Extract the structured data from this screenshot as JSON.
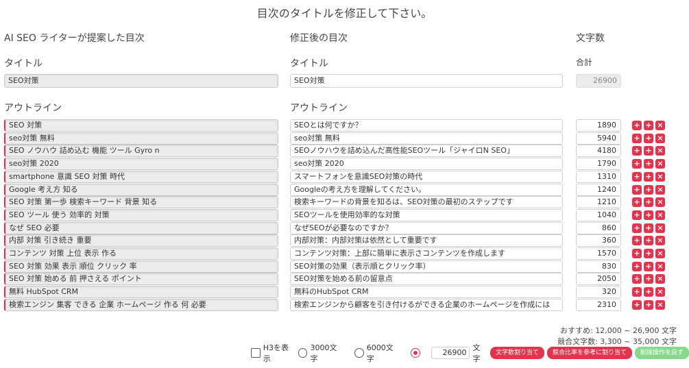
{
  "title": "目次のタイトルを修正して下さい。",
  "columns": {
    "ai_header": "AI SEO ライターが提案した目次",
    "edit_header": "修正後の目次",
    "count_header": "文字数"
  },
  "labels": {
    "title_label": "タイトル",
    "outline_label": "アウトライン",
    "total_label": "合計"
  },
  "title_fields": {
    "ai_title": "SEO対策",
    "edit_title": "SEO対策",
    "total": "26900"
  },
  "rows": [
    {
      "ai": "SEO 対策",
      "edit": "SEOとは何ですか？",
      "count": "1890"
    },
    {
      "ai": "seo対策 無料",
      "edit": "seo対策 無料",
      "count": "5940"
    },
    {
      "ai": "SEO ノウハウ 詰め込む 機能 ツール Gyro n",
      "edit": "SEOノウハウを詰め込んだ高性能SEOツール「ジャイロN SEO」",
      "count": "4180"
    },
    {
      "ai": "seo対策 2020",
      "edit": "seo対策 2020",
      "count": "1790"
    },
    {
      "ai": "smartphone 意識 SEO 対策 時代",
      "edit": "スマートフォンを意識SEO対策の時代",
      "count": "1310"
    },
    {
      "ai": "Google 考え方 知る",
      "edit": "Googleの考え方を理解してください。",
      "count": "1240"
    },
    {
      "ai": "SEO 対策 第一歩 検索キーワード 背景 知る",
      "edit": "検索キーワードの背景を知るは、SEO対策の最初のステップです",
      "count": "1210"
    },
    {
      "ai": "SEO ツール 使う 効率的 対策",
      "edit": "SEOツールを使用効率的な対策",
      "count": "1040"
    },
    {
      "ai": "なぜ SEO 必要",
      "edit": "なぜSEOが必要なのですか？",
      "count": "860"
    },
    {
      "ai": "内部 対策 引き続き 重要",
      "edit": "内部対策：内部対策は依然として重要です",
      "count": "360"
    },
    {
      "ai": "コンテンツ 対策 上位 表示 作る",
      "edit": "コンテンツ対策：上部に簡単に表示さコンテンツを作成します",
      "count": "1570"
    },
    {
      "ai": "SEO 対策 効果 表示 順位 クリック 率",
      "edit": "SEO対策の効果（表示順とクリック率）",
      "count": "830"
    },
    {
      "ai": "SEO 対策 始める 前 押さえる ポイント",
      "edit": "SEO対策を始める前の留意点",
      "count": "2050"
    },
    {
      "ai": "無料 HubSpot CRM",
      "edit": "無料のHubSpot CRM",
      "count": "320"
    },
    {
      "ai": "検索エンジン 集客 できる 企業 ホームページ 作る 何 必要",
      "edit": "検索エンジンから顧客を引き付けるができる企業のホームページを作成には",
      "count": "2310"
    }
  ],
  "row_buttons": [
    "+",
    "+",
    "×"
  ],
  "footer": {
    "recommend": "おすすめ: 12,000 ~ 26,900 文字",
    "competitor": "競合文字数: 3,300 ~ 35,000 文字"
  },
  "controls": {
    "h3_label": "H3を表示",
    "opt_3000": "3000文字",
    "opt_6000": "6000文字",
    "custom_value": "26900",
    "unit": "文字",
    "btn_allocate": "文字数割り当て",
    "btn_competitor": "競合比率を参考に割り当て",
    "btn_undo": "削除操作を戻す"
  }
}
